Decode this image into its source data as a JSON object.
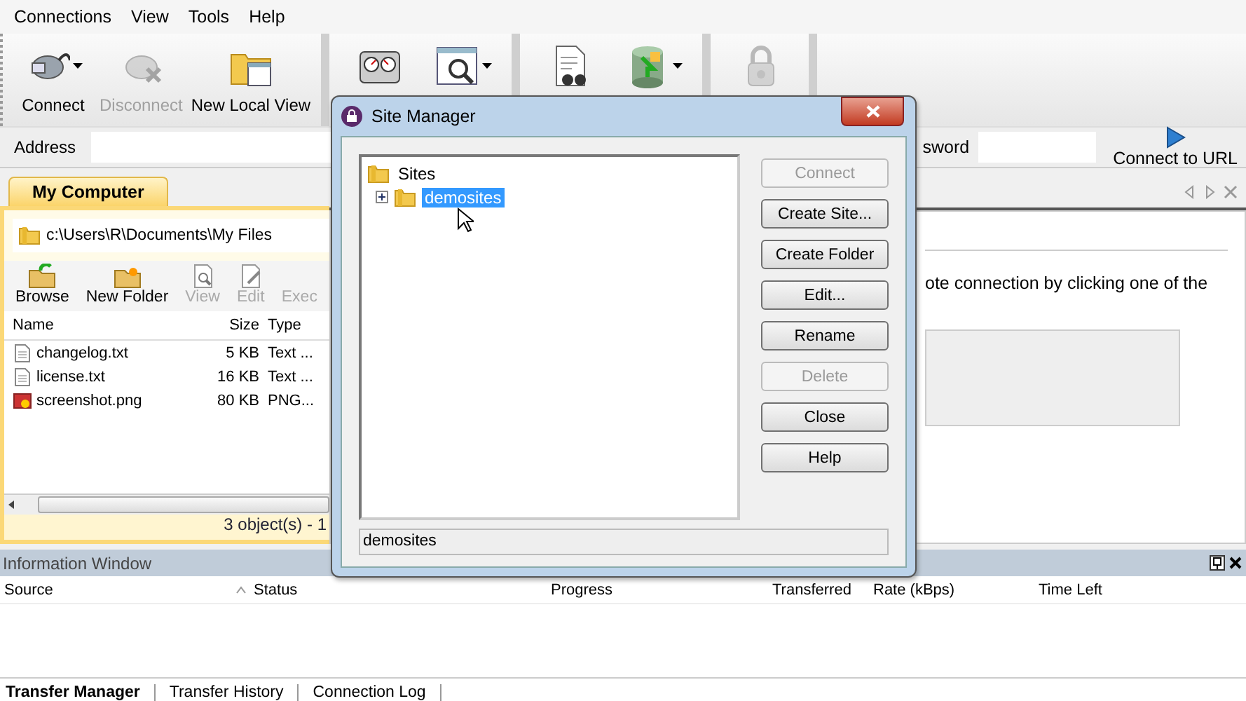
{
  "menu": [
    {
      "label": "Connections"
    },
    {
      "label": "View"
    },
    {
      "label": "Tools"
    },
    {
      "label": "Help"
    }
  ],
  "toolbar": {
    "groups": [
      [
        {
          "label": "Connect",
          "disabled": false,
          "dropdown": true
        },
        {
          "label": "Disconnect",
          "disabled": true,
          "dropdown": false
        },
        {
          "label": "New Local View",
          "disabled": false,
          "dropdown": false
        }
      ],
      [
        {
          "disabled": false,
          "dropdown": false
        },
        {
          "disabled": false,
          "dropdown": true
        }
      ],
      [
        {
          "disabled": false,
          "dropdown": false
        },
        {
          "disabled": false,
          "dropdown": true
        }
      ],
      [
        {
          "disabled": true,
          "dropdown": false
        }
      ]
    ]
  },
  "address_bar": {
    "address_label": "Address",
    "password_label": "sword",
    "connect_button": "Connect to URL"
  },
  "local_panel": {
    "tab": {
      "label": "My Computer",
      "selected": true
    },
    "path": "c:\\Users\\R\\Documents\\My Files",
    "toolbar": [
      {
        "label": "Browse",
        "disabled": false
      },
      {
        "label": "New Folder",
        "disabled": false
      },
      {
        "label": "View",
        "disabled": true
      },
      {
        "label": "Edit",
        "disabled": true
      },
      {
        "label": "Exec",
        "disabled": true
      }
    ],
    "columns": [
      "Name",
      "Size",
      "Type"
    ],
    "rows": [
      {
        "kind": "text",
        "name": "changelog.txt",
        "size": "5 KB",
        "type": "Text ..."
      },
      {
        "kind": "text",
        "name": "license.txt",
        "size": "16 KB",
        "type": "Text ..."
      },
      {
        "kind": "image",
        "name": "screenshot.png",
        "size": "80 KB",
        "type": "PNG..."
      }
    ],
    "status": "3 object(s) - 1"
  },
  "remote_panel": {
    "message": "ote connection by clicking one of the"
  },
  "site_manager": {
    "title": "Site Manager",
    "tree": [
      {
        "label": "Sites",
        "selected": false,
        "children": [
          {
            "label": "demosites",
            "selected": true,
            "expanded": false
          }
        ]
      }
    ],
    "buttons": [
      {
        "label": "Connect",
        "disabled": true
      },
      {
        "label": "Create Site...",
        "disabled": false
      },
      {
        "label": "Create Folder",
        "disabled": false
      },
      {
        "label": "Edit...",
        "disabled": false
      },
      {
        "label": "Rename",
        "disabled": false
      },
      {
        "label": "Delete",
        "disabled": true
      },
      {
        "label": "Close",
        "disabled": false
      },
      {
        "label": "Help",
        "disabled": false
      }
    ],
    "status": "demosites"
  },
  "information_window": {
    "title": "Information Window",
    "columns": [
      {
        "label": "Source",
        "sorted": true
      },
      {
        "label": "Status",
        "sorted": false
      },
      {
        "label": "Progress",
        "sorted": false
      },
      {
        "label": "Transferred",
        "sorted": false
      },
      {
        "label": "Rate (kBps)",
        "sorted": false
      },
      {
        "label": "Time Left",
        "sorted": false
      }
    ],
    "tabs": [
      {
        "label": "Transfer Manager",
        "selected": true
      },
      {
        "label": "Transfer History",
        "selected": false
      },
      {
        "label": "Connection Log",
        "selected": false
      }
    ]
  }
}
